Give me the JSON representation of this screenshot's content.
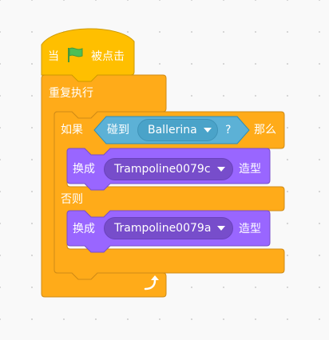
{
  "script": {
    "hat": {
      "prefix": "当",
      "suffix": "被点击",
      "icon": "green-flag-icon"
    },
    "forever": {
      "label": "重复执行",
      "end_icon": "loop-arrow-icon"
    },
    "if_else": {
      "if_label": "如果",
      "then_label": "那么",
      "else_label": "否则"
    },
    "condition": {
      "label": "碰到",
      "object": "Ballerina",
      "question_mark": "?"
    },
    "switch_costume_1": {
      "label": "换成",
      "costume": "Trampoline0079c",
      "suffix": "造型"
    },
    "switch_costume_2": {
      "label": "换成",
      "costume": "Trampoline0079a",
      "suffix": "造型"
    }
  },
  "colors": {
    "control": "#ffab19",
    "control_dark": "#cf8b17",
    "events": "#ffbf00",
    "looks": "#9966ff",
    "looks_dark": "#774dcb",
    "sensing": "#5cb1d6",
    "flag_green": "#4cbf56",
    "canvas": "#f9f9f9"
  }
}
